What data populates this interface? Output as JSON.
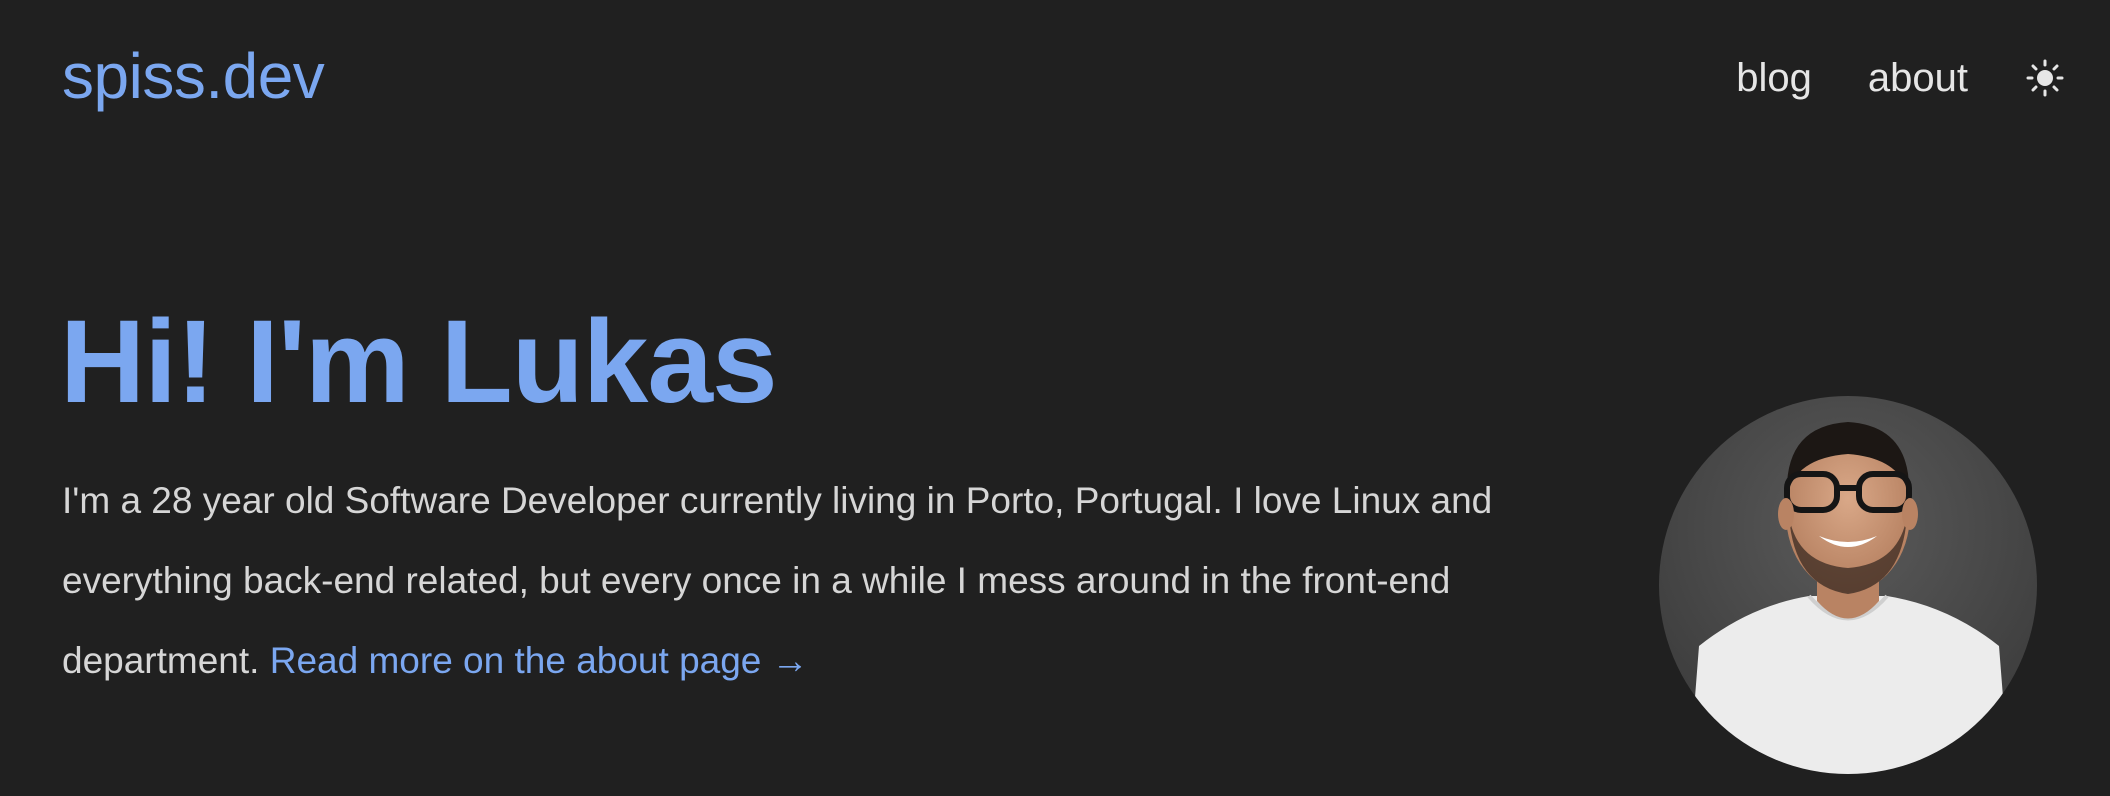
{
  "header": {
    "logo": "spiss.dev",
    "nav": [
      {
        "label": "blog"
      },
      {
        "label": "about"
      }
    ],
    "theme_toggle_icon": "sun-icon"
  },
  "hero": {
    "title": "Hi! I'm Lukas",
    "intro_text": "I'm a 28 year old Software Developer currently living in Porto, Portugal. I love Linux and everything back-end related, but every once in a while I mess around in the front-end department.",
    "intro_link": "Read more on the about page →",
    "avatar_icon": "profile-photo"
  },
  "colors": {
    "background": "#202020",
    "accent": "#7ba7f0",
    "text": "#d6d6d6"
  }
}
